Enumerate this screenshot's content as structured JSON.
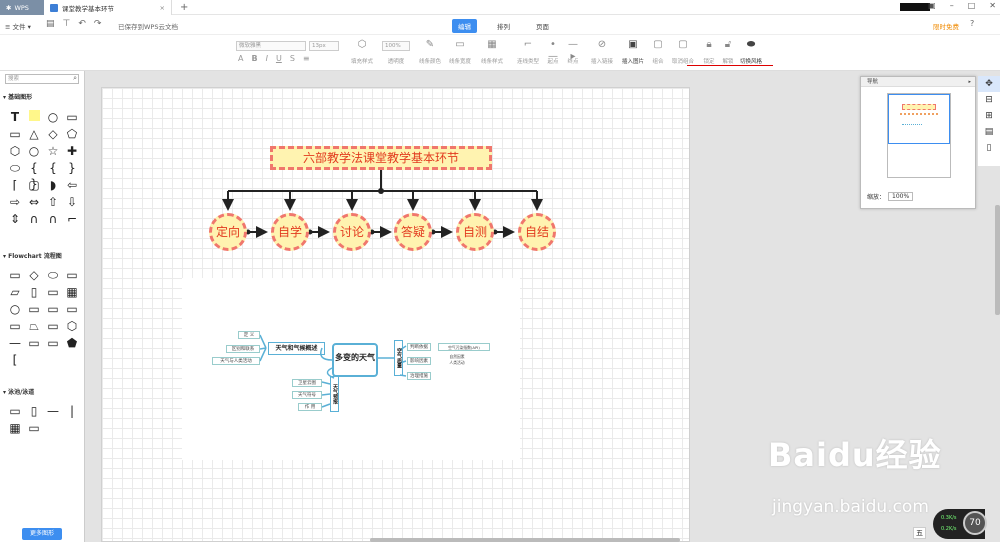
{
  "window": {
    "wps_tab": "WPS",
    "doc_tab": "课堂教学基本环节",
    "new_tab": "+"
  },
  "menu": {
    "file": "文件",
    "saved_status": "已保存到WPS云文档",
    "tabs": [
      "编辑",
      "排列",
      "页面"
    ],
    "limited_offer": "限时免费",
    "help": "?"
  },
  "toolbar": {
    "font_family": "微软雅黑",
    "font_size": "13px",
    "opacity": "100%",
    "items": [
      {
        "label": "填充样式",
        "icon": "fill-style-icon"
      },
      {
        "label": "透明度",
        "icon": "opacity-icon"
      },
      {
        "label": "线条颜色",
        "icon": "line-color-icon"
      },
      {
        "label": "线条宽度",
        "icon": "line-width-icon"
      },
      {
        "label": "线条样式",
        "icon": "line-style-icon"
      },
      {
        "label": "连线类型",
        "icon": "connector-type-icon"
      },
      {
        "label": "起点",
        "icon": "start-arrow-icon"
      },
      {
        "label": "终点",
        "icon": "end-arrow-icon"
      },
      {
        "label": "插入链接",
        "icon": "insert-link-icon"
      },
      {
        "label": "插入图片",
        "icon": "insert-image-icon"
      },
      {
        "label": "组合",
        "icon": "group-icon"
      },
      {
        "label": "取消组合",
        "icon": "ungroup-icon"
      },
      {
        "label": "锁定",
        "icon": "lock-icon"
      },
      {
        "label": "解锁",
        "icon": "unlock-icon"
      },
      {
        "label": "切换风格",
        "icon": "switch-style-icon"
      }
    ]
  },
  "left_panel": {
    "search_placeholder": "搜索",
    "sections": [
      "基础图形",
      "Flowchart 流程图",
      "泳池/泳道"
    ],
    "more_shapes": "更多图形"
  },
  "diagram": {
    "title": "六部教学法课堂教学基本环节",
    "steps": [
      "定向",
      "自学",
      "讨论",
      "答疑",
      "自测",
      "自结"
    ]
  },
  "mindmap": {
    "center": "多变的天气",
    "branch_left": "天气和气候概述",
    "left_leaves": [
      "定 义",
      "区别和联系",
      "天气与人类活动"
    ],
    "branch_bottom": "天气预报",
    "bottom_leaves": [
      "卫星云图",
      "天气符号",
      "作 用"
    ],
    "branch_right": "空气质量",
    "right_leaves": [
      "判断依据",
      "影响因素",
      "治理措施"
    ],
    "right_sub": [
      "空气污染指数(API)",
      "自然因素",
      "人类活动"
    ]
  },
  "navigator": {
    "title": "导航",
    "zoom_label": "缩放：",
    "zoom_value": "100%"
  },
  "watermark": {
    "brand": "Baidu经验",
    "url": "jingyan.baidu.com"
  },
  "speed": {
    "up": "0.3K/s",
    "down": "0.2K/s",
    "percent": "70"
  },
  "ime": {
    "label": "五"
  }
}
